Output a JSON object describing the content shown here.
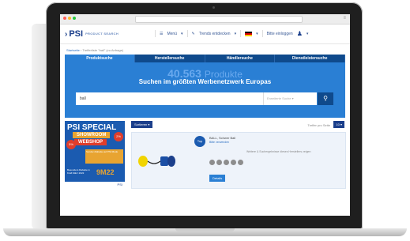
{
  "browser": {
    "url": ""
  },
  "header": {
    "logo": "PSI",
    "logo_sub": "PRODUCT SEARCH",
    "menu_label": "Menü",
    "trends_label": "Trends entdecken",
    "language": "DE",
    "login_label": "Bitte einloggen"
  },
  "breadcrumb": {
    "home": "Startseite",
    "rest": "Trefferliste \"ball\" (zu Anfrage)"
  },
  "tabs": [
    "Produktsuche",
    "Herstellersuche",
    "Händlersuche",
    "Dienstleistersuche"
  ],
  "hero": {
    "count_number": "40.563",
    "count_word": "Produkte",
    "headline": "Suchen im größten Werbenetzwerk Europas",
    "search_value": "ball",
    "search_select": "Erweiterte Suche"
  },
  "promo": {
    "title": "PSI SPECIAL",
    "showroom": "SHOWROOM",
    "webshop": "WEBSHOP",
    "badge1": "2%",
    "badge2": "5%",
    "band_text": "Sonder-Rabatte auf PSI Mode",
    "small_text": "Besonders Rabatte in Kraft März 2022",
    "date": "9M22",
    "footer": "PSI"
  },
  "results": {
    "sort_label": "Sortieren",
    "perpage_label": "Treffer pro Seite",
    "perpage_value": "10",
    "product_badge": "Top",
    "product_name": "BALL, Schwer Ball",
    "product_sub": "Bitte verwenden",
    "product_meta": "Weitere & Suchergebnisse dieses Herstellers zeigen",
    "details_label": "Details"
  },
  "colors": {
    "brand": "#1b3f8b",
    "hero": "#2a7fd4",
    "accent_orange": "#e8a431",
    "accent_red": "#e03d2b"
  }
}
